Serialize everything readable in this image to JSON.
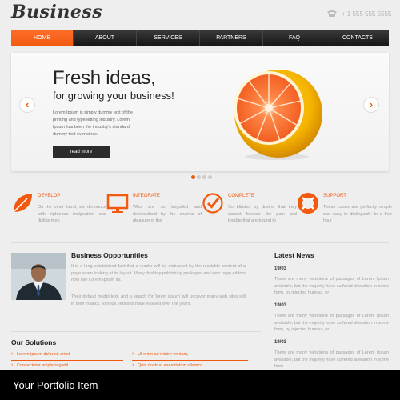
{
  "header": {
    "logo": "Business",
    "phone": "+ 1 555 555 5555",
    "phone_icon": "phone-icon"
  },
  "nav": {
    "items": [
      "HOME",
      "ABOUT",
      "SERVICES",
      "PARTNERS",
      "FAQ",
      "CONTACTS"
    ],
    "active_index": 0
  },
  "hero": {
    "title": "Fresh ideas,",
    "subtitle": "for growing your business!",
    "body": "Lorem Ipsum is simply dummy text of the printing and typesetting industry. Lorem Ipsum has been the industry's standard dummy text ever since.",
    "button": "read more",
    "image": "grapefruit-image",
    "slides": 4,
    "active_slide": 0
  },
  "features": [
    {
      "title": "DEVELOP",
      "icon": "leaf-icon",
      "text": "On the other hand, we denounce with righteous indignation and dislike men"
    },
    {
      "title": "INTEGRATE",
      "icon": "monitor-icon",
      "text": "Who are so beguiled and demoralized by the charms of pleasure of the"
    },
    {
      "title": "COMPLETE",
      "icon": "checkmark-icon",
      "text": "So blinded by desire, that they cannot foresee the pain and trouble that are bound to"
    },
    {
      "title": "SUPPORT",
      "icon": "lifebuoy-icon",
      "text": "These cases are perfectly simple and easy to distinguish. In a free hour"
    }
  ],
  "business": {
    "title": "Business Opportunities",
    "photo": "businessman-photo",
    "p1": "It is a long established fact that a reader will be distracted by the readable content of a page when looking at its layout. Many desktop publishing packages and web page editors now use Lorem Ipsum as.",
    "p2": "Their default model text, and a search for 'lorem ipsum' will uncover many web sites still in their infancy. Various versions have evolved over the years."
  },
  "news": {
    "title": "Latest News",
    "items": [
      {
        "date": "19/03",
        "text": "There are many variations of passages of Lorem Ipsum available, but the majority have suffered alteration in some form, by injected humour, or"
      },
      {
        "date": "19/03",
        "text": "There are many variations of passages of Lorem Ipsum available, but the majority have suffered alteration in some form, by injected humour, or"
      },
      {
        "date": "19/03",
        "text": "There are many variations of passages of Lorem Ipsum available, but the majority have suffered alteration in some form"
      }
    ]
  },
  "solutions": {
    "title": "Our Solutions",
    "col1": [
      "Lorem ipsum dolor sit amet",
      "Consectetur adipiscing elit"
    ],
    "col2": [
      "Ut enim ad minim veniam,",
      "Quis nostrud exercitation ullamco"
    ]
  },
  "caption": "Your Portfolio Item",
  "colors": {
    "accent": "#f15a0f",
    "nav_dark": "#222222",
    "background": "#eeeeee"
  }
}
